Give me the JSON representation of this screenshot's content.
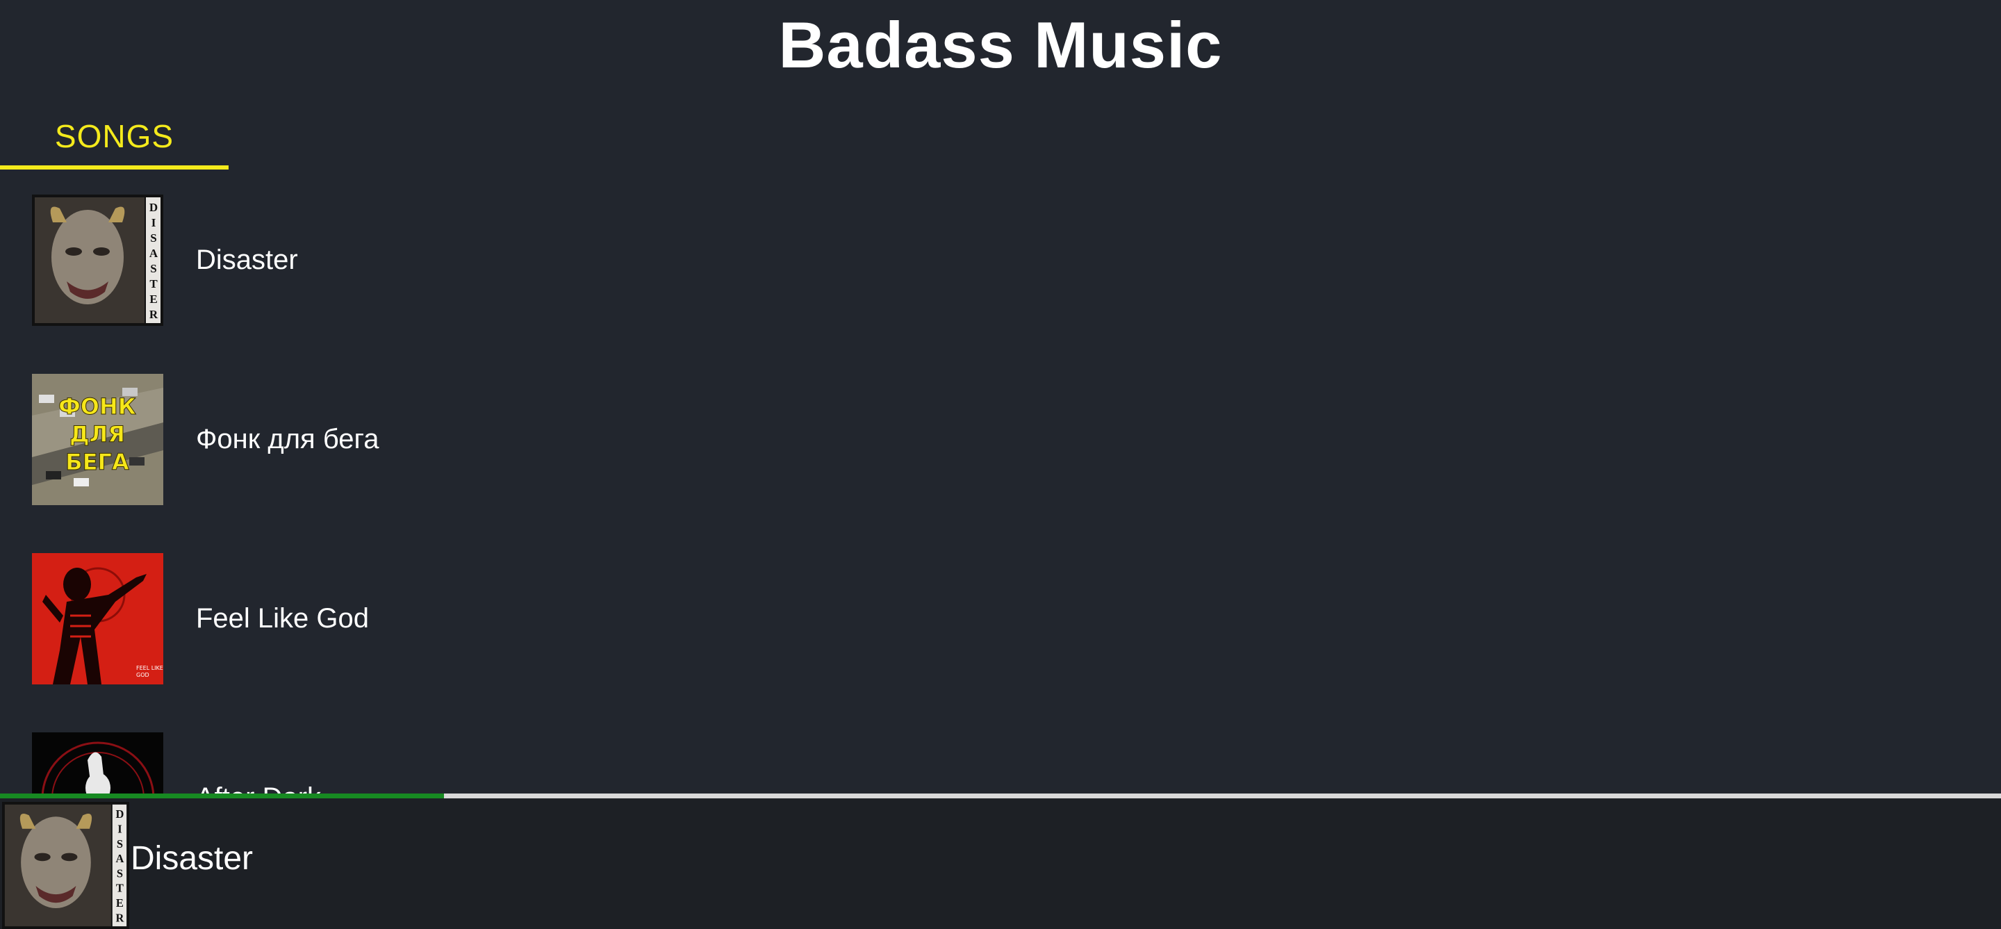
{
  "app": {
    "title": "Badass Music"
  },
  "tabs": [
    {
      "label": "SONGS",
      "active": true
    }
  ],
  "songs": [
    {
      "title": "Disaster",
      "cover_icon": "disaster-cover-image",
      "cover_text": "DISASTER"
    },
    {
      "title": "Фонк для бега",
      "cover_icon": "fonk-cover-image",
      "cover_text": "ФОНК ДЛЯ БЕГА"
    },
    {
      "title": "Feel Like God",
      "cover_icon": "feel-like-god-cover-image",
      "cover_text": "FEEL LIKE GOD"
    },
    {
      "title": "After Dark",
      "cover_icon": "after-dark-cover-image"
    }
  ],
  "player": {
    "title": "Disaster",
    "progress": 0.222
  },
  "colors": {
    "background": "#22262e",
    "accent": "#f4ea1c",
    "player_background": "#1d2025",
    "progress_fill": "#178a22",
    "progress_track": "#d9d9d9"
  }
}
